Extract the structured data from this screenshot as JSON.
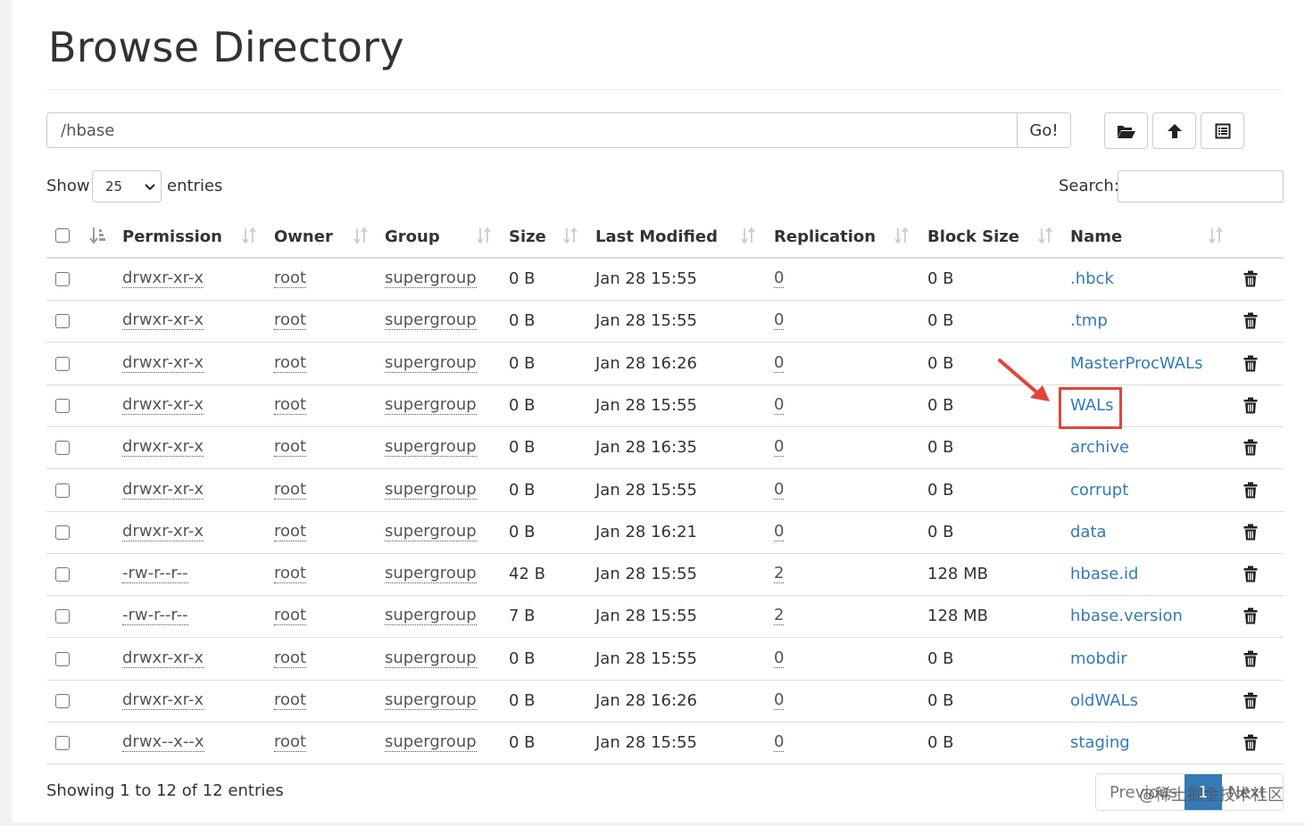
{
  "page": {
    "title": "Browse Directory"
  },
  "path_bar": {
    "value": "/hbase",
    "go_label": "Go!"
  },
  "toolbar": {
    "icons": [
      "folder-open-icon",
      "cloud-upload-icon",
      "list-alt-icon"
    ]
  },
  "length_control": {
    "show_label": "Show",
    "selected": "25",
    "entries_label": "entries"
  },
  "search": {
    "label": "Search:",
    "value": ""
  },
  "table": {
    "columns": [
      "Permission",
      "Owner",
      "Group",
      "Size",
      "Last Modified",
      "Replication",
      "Block Size",
      "Name"
    ],
    "rows": [
      {
        "permission": "drwxr-xr-x",
        "owner": "root",
        "group": "supergroup",
        "size": "0 B",
        "modified": "Jan 28 15:55",
        "replication": "0",
        "block_size": "0 B",
        "name": ".hbck"
      },
      {
        "permission": "drwxr-xr-x",
        "owner": "root",
        "group": "supergroup",
        "size": "0 B",
        "modified": "Jan 28 15:55",
        "replication": "0",
        "block_size": "0 B",
        "name": ".tmp"
      },
      {
        "permission": "drwxr-xr-x",
        "owner": "root",
        "group": "supergroup",
        "size": "0 B",
        "modified": "Jan 28 16:26",
        "replication": "0",
        "block_size": "0 B",
        "name": "MasterProcWALs"
      },
      {
        "permission": "drwxr-xr-x",
        "owner": "root",
        "group": "supergroup",
        "size": "0 B",
        "modified": "Jan 28 15:55",
        "replication": "0",
        "block_size": "0 B",
        "name": "WALs"
      },
      {
        "permission": "drwxr-xr-x",
        "owner": "root",
        "group": "supergroup",
        "size": "0 B",
        "modified": "Jan 28 16:35",
        "replication": "0",
        "block_size": "0 B",
        "name": "archive"
      },
      {
        "permission": "drwxr-xr-x",
        "owner": "root",
        "group": "supergroup",
        "size": "0 B",
        "modified": "Jan 28 15:55",
        "replication": "0",
        "block_size": "0 B",
        "name": "corrupt"
      },
      {
        "permission": "drwxr-xr-x",
        "owner": "root",
        "group": "supergroup",
        "size": "0 B",
        "modified": "Jan 28 16:21",
        "replication": "0",
        "block_size": "0 B",
        "name": "data"
      },
      {
        "permission": "-rw-r--r--",
        "owner": "root",
        "group": "supergroup",
        "size": "42 B",
        "modified": "Jan 28 15:55",
        "replication": "2",
        "block_size": "128 MB",
        "name": "hbase.id"
      },
      {
        "permission": "-rw-r--r--",
        "owner": "root",
        "group": "supergroup",
        "size": "7 B",
        "modified": "Jan 28 15:55",
        "replication": "2",
        "block_size": "128 MB",
        "name": "hbase.version"
      },
      {
        "permission": "drwxr-xr-x",
        "owner": "root",
        "group": "supergroup",
        "size": "0 B",
        "modified": "Jan 28 15:55",
        "replication": "0",
        "block_size": "0 B",
        "name": "mobdir"
      },
      {
        "permission": "drwxr-xr-x",
        "owner": "root",
        "group": "supergroup",
        "size": "0 B",
        "modified": "Jan 28 16:26",
        "replication": "0",
        "block_size": "0 B",
        "name": "oldWALs"
      },
      {
        "permission": "drwx--x--x",
        "owner": "root",
        "group": "supergroup",
        "size": "0 B",
        "modified": "Jan 28 15:55",
        "replication": "0",
        "block_size": "0 B",
        "name": "staging"
      }
    ]
  },
  "footer": {
    "info": "Showing 1 to 12 of 12 entries",
    "pagination": {
      "previous": "Previous",
      "current": "1",
      "next": "Next"
    },
    "watermark": "@稀土掘金技术社区"
  },
  "colors": {
    "link": "#337ab7",
    "annotation": "#e0443a",
    "active_page": "#337ab7"
  }
}
